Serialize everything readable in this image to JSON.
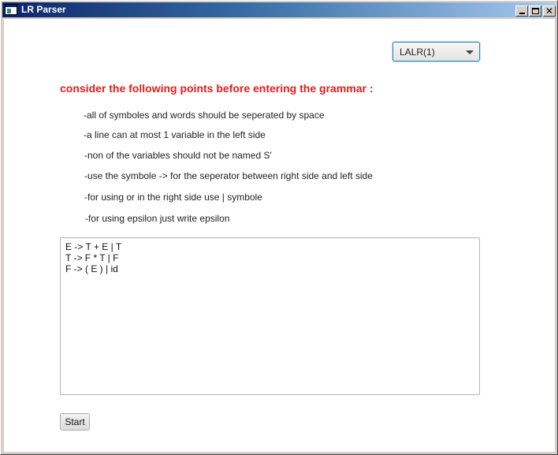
{
  "window": {
    "title": "LR Parser"
  },
  "parser": {
    "selected": "LALR(1)"
  },
  "instructions": {
    "heading": "consider the following points before entering the grammar :",
    "points": [
      "-all of symboles and words should be seperated by space",
      "-a line can at most 1 variable in the left side",
      "-non of the variables should not be named S'",
      "-use the symbole -> for the seperator between right side and left side",
      "-for using or in the right side use | symbole",
      "-for using epsilon just write epsilon"
    ]
  },
  "grammar": {
    "lines": [
      "E -> T + E | T",
      "T -> F * T | F",
      "F -> ( E ) | id"
    ]
  },
  "actions": {
    "start_label": "Start"
  },
  "colors": {
    "heading": "#e51c1c",
    "titlebar_start": "#0a246a",
    "titlebar_end": "#a6caf0",
    "focus_border": "#3c7fb1"
  }
}
